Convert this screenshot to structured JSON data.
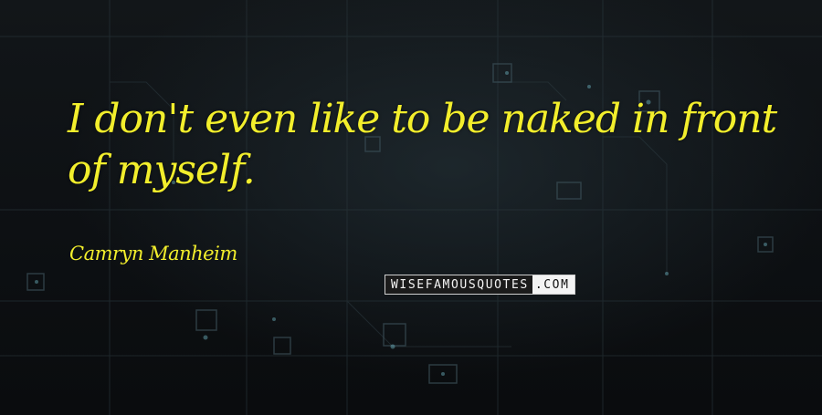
{
  "quote": {
    "text": "I don't even like to be naked in front of myself.",
    "author": "Camryn Manheim"
  },
  "watermark": {
    "brand": "WISEFAMOUSQUOTES",
    "suffix": ".COM"
  },
  "colors": {
    "quote_text": "#f2ee2c",
    "background": "#0b0d10"
  },
  "background_motif": "dark circuit-board pattern"
}
